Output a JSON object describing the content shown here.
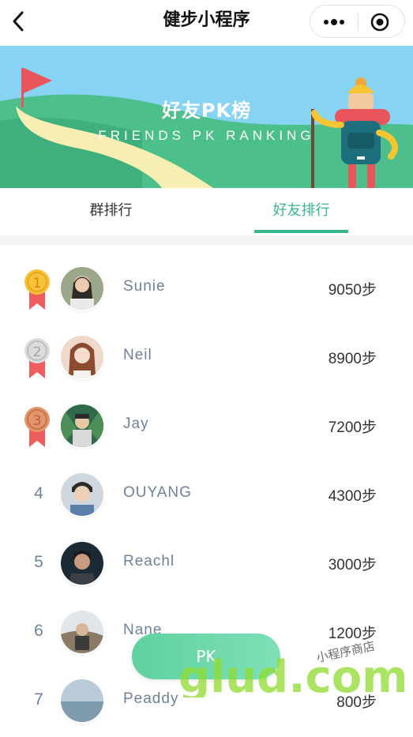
{
  "navbar": {
    "title": "健步小程序",
    "back_icon": "chevron-left-icon",
    "more_icon": "more-dots-icon",
    "close_icon": "target-close-icon"
  },
  "banner": {
    "title": "好友PK榜",
    "subtitle": "FRIENDS PK RANKING",
    "colors": {
      "sky": "#87d3f3",
      "hill": "#4cbf8a",
      "path": "#f6eeb3",
      "flag": "#e9555a"
    }
  },
  "tabs": [
    {
      "label": "群排行",
      "active": false
    },
    {
      "label": "好友排行",
      "active": true
    }
  ],
  "accent_color": "#37b98a",
  "ranking": [
    {
      "rank": "1",
      "medal": "gold",
      "name": "Sunie",
      "steps": "9050步"
    },
    {
      "rank": "2",
      "medal": "silver",
      "name": "Neil",
      "steps": "8900步"
    },
    {
      "rank": "3",
      "medal": "bronze",
      "name": "Jay",
      "steps": "7200步"
    },
    {
      "rank": "4",
      "medal": null,
      "name": "OUYANG",
      "steps": "4300步"
    },
    {
      "rank": "5",
      "medal": null,
      "name": "Reachl",
      "steps": "3000步"
    },
    {
      "rank": "6",
      "medal": null,
      "name": "Nane",
      "steps": "1200步"
    },
    {
      "rank": "7",
      "medal": null,
      "name": "Peaddy",
      "steps": "800步"
    }
  ],
  "pk_button": {
    "label": "PK"
  },
  "watermark": {
    "text": "glud.com",
    "tagline": "小程序商店"
  }
}
